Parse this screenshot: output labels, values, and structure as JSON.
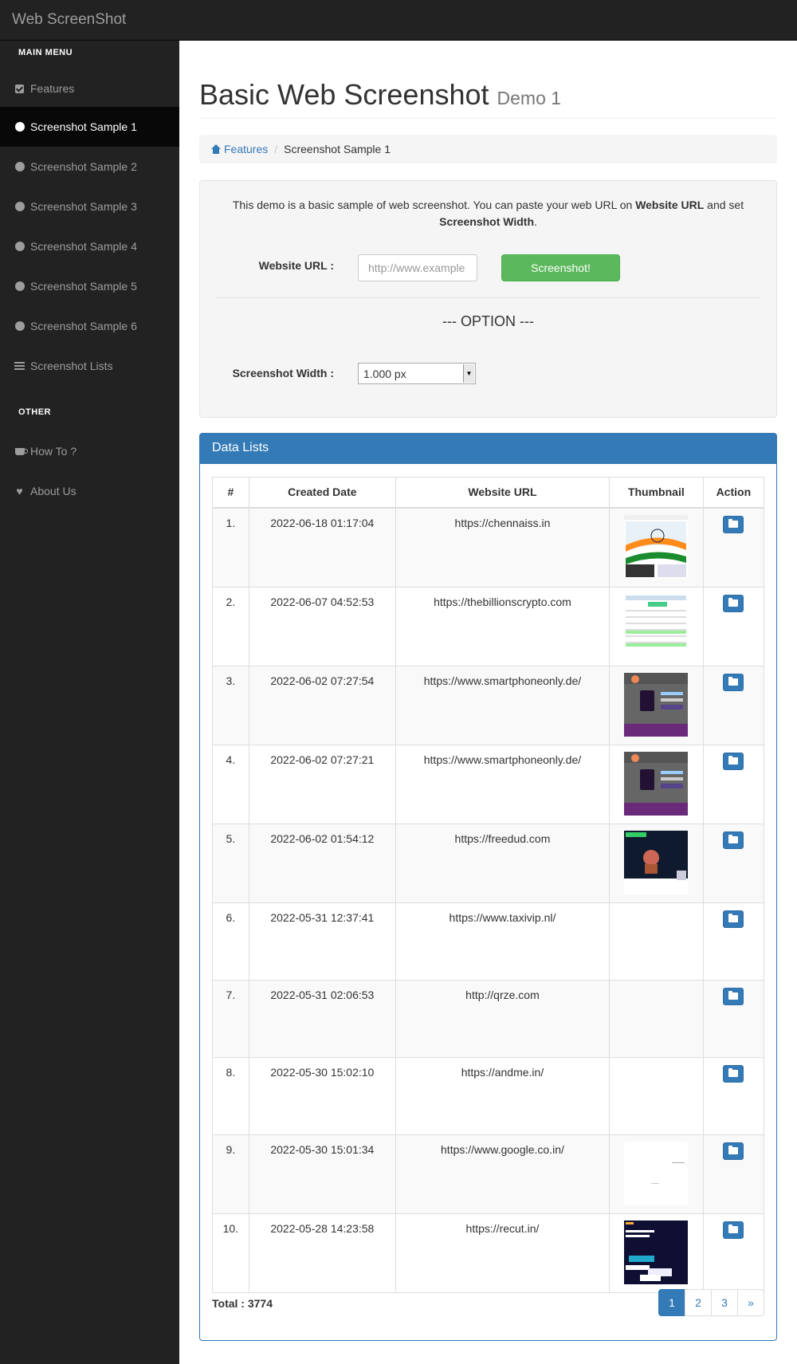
{
  "brand": "Web ScreenShot",
  "sidebar": {
    "main_header": "MAIN MENU",
    "other_header": "OTHER",
    "items": [
      {
        "label": "Features",
        "icon": "check-square-icon"
      },
      {
        "label": "Screenshot Sample 1",
        "icon": "circle-icon",
        "active": true
      },
      {
        "label": "Screenshot Sample 2",
        "icon": "circle-icon"
      },
      {
        "label": "Screenshot Sample 3",
        "icon": "circle-icon"
      },
      {
        "label": "Screenshot Sample 4",
        "icon": "circle-icon"
      },
      {
        "label": "Screenshot Sample 5",
        "icon": "circle-icon"
      },
      {
        "label": "Screenshot Sample 6",
        "icon": "circle-icon"
      },
      {
        "label": "Screenshot Lists",
        "icon": "list-icon"
      }
    ],
    "other_items": [
      {
        "label": "How To ?",
        "icon": "coffee-icon"
      },
      {
        "label": "About Us",
        "icon": "heart-icon"
      }
    ]
  },
  "page": {
    "title": "Basic Web Screenshot",
    "subtitle": "Demo 1"
  },
  "breadcrumb": {
    "home": "Features",
    "current": "Screenshot Sample 1"
  },
  "form": {
    "intro_1": "This demo is a basic sample of web screenshot. You can paste your web URL on ",
    "intro_bold_1": "Website URL",
    "intro_2": " and set ",
    "intro_bold_2": "Screenshot Width",
    "intro_3": ".",
    "url_label": "Website URL :",
    "url_placeholder": "http://www.example",
    "button": "Screenshot!",
    "option_header": "--- OPTION ---",
    "width_label": "Screenshot Width :",
    "width_value": "1.000 px"
  },
  "panel": {
    "title": "Data Lists",
    "columns": [
      "#",
      "Created Date",
      "Website URL",
      "Thumbnail",
      "Action"
    ],
    "rows": [
      {
        "num": "1.",
        "date": "2022-06-18 01:17:04",
        "url": "https://chennaiss.in",
        "thumb": "india"
      },
      {
        "num": "2.",
        "date": "2022-06-07 04:52:53",
        "url": "https://thebillionscrypto.com",
        "thumb": "table"
      },
      {
        "num": "3.",
        "date": "2022-06-02 07:27:54",
        "url": "https://www.smartphoneonly.de/",
        "thumb": "phone"
      },
      {
        "num": "4.",
        "date": "2022-06-02 07:27:21",
        "url": "https://www.smartphoneonly.de/",
        "thumb": "phone"
      },
      {
        "num": "5.",
        "date": "2022-06-02 01:54:12",
        "url": "https://freedud.com",
        "thumb": "dark"
      },
      {
        "num": "6.",
        "date": "2022-05-31 12:37:41",
        "url": "https://www.taxivip.nl/",
        "thumb": "none"
      },
      {
        "num": "7.",
        "date": "2022-05-31 02:06:53",
        "url": "http://qrze.com",
        "thumb": "none"
      },
      {
        "num": "8.",
        "date": "2022-05-30 15:02:10",
        "url": "https://andme.in/",
        "thumb": "none"
      },
      {
        "num": "9.",
        "date": "2022-05-30 15:01:34",
        "url": "https://www.google.co.in/",
        "thumb": "blank"
      },
      {
        "num": "10.",
        "date": "2022-05-28 14:23:58",
        "url": "https://recut.in/",
        "thumb": "navy"
      }
    ],
    "total": "Total : 3774",
    "pages": [
      "1",
      "2",
      "3",
      "»"
    ],
    "active_page": "1"
  }
}
